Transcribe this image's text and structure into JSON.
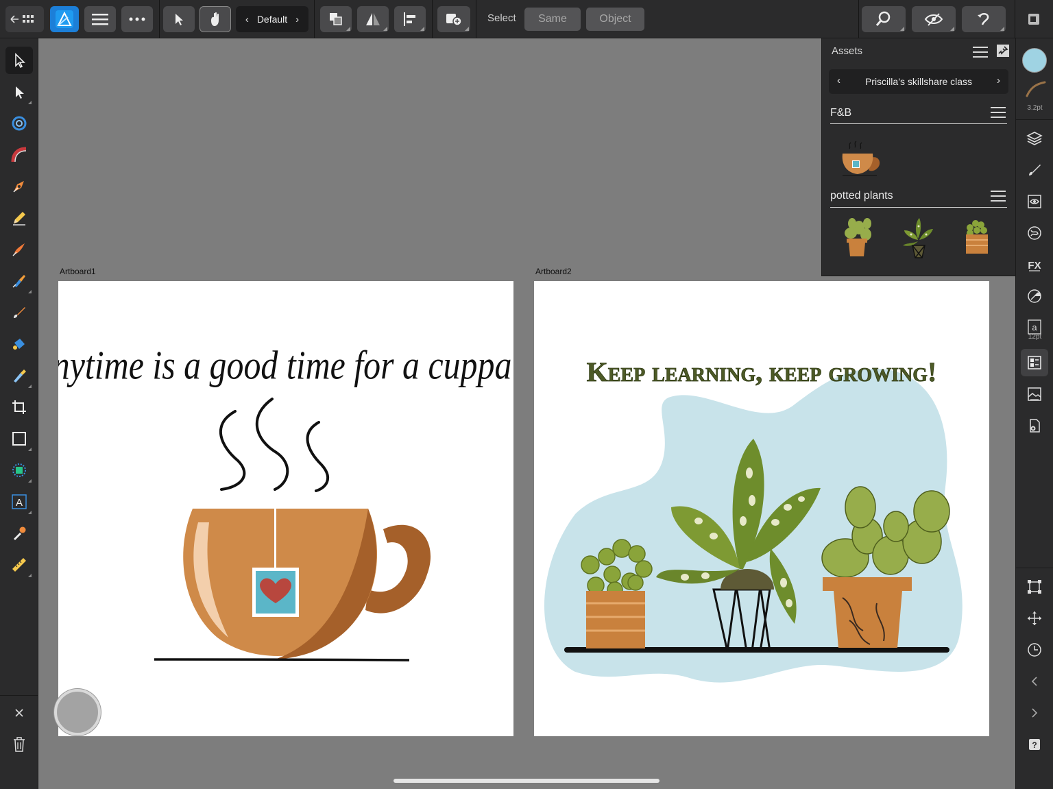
{
  "toolbar": {
    "context_label": "Default",
    "select_label": "Select",
    "same_label": "Same",
    "object_label": "Object"
  },
  "stroke_panel": {
    "width_label": "3.2pt",
    "color": "#9fd3e3"
  },
  "text_panel": {
    "size_label": "12pt"
  },
  "assets": {
    "title": "Assets",
    "library_name": "Priscilla’s skillshare class",
    "categories": [
      {
        "name": "F&B",
        "items": [
          "teacup-asset"
        ]
      },
      {
        "name": "potted plants",
        "items": [
          "cactus-pot-asset",
          "dotted-plant-asset",
          "round-cactus-asset"
        ]
      }
    ]
  },
  "artboards": [
    {
      "label": "Artboard1",
      "headline": "Anytime is a good time for a cuppa!"
    },
    {
      "label": "Artboard2",
      "headline": "Keep learning, keep growing!"
    }
  ],
  "colors": {
    "cup": "#cf8a49",
    "cup_shadow": "#a5602a",
    "teabag": "#5bb6c8",
    "heart": "#b8473e",
    "blob": "#c8e3ea"
  }
}
